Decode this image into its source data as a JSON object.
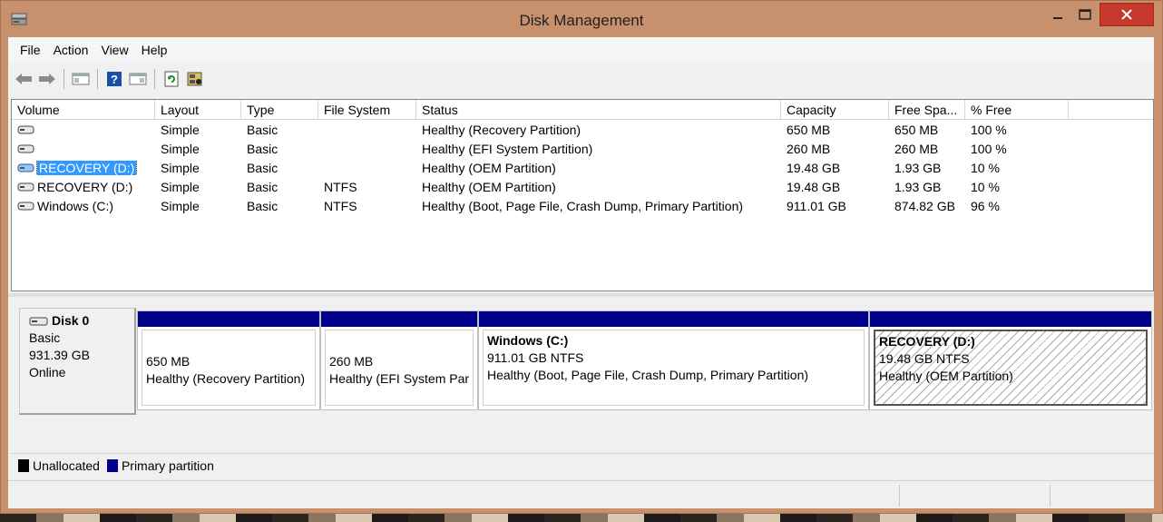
{
  "window": {
    "title": "Disk Management",
    "accent_color": "#c7916d",
    "close_color": "#c7372c"
  },
  "menu": [
    "File",
    "Action",
    "View",
    "Help"
  ],
  "toolbar_icons": [
    "back-arrow-icon",
    "forward-arrow-icon",
    "console-tree-icon",
    "help-icon",
    "properties-icon",
    "refresh-icon",
    "rescan-disks-icon"
  ],
  "volume_list": {
    "columns": [
      "Volume",
      "Layout",
      "Type",
      "File System",
      "Status",
      "Capacity",
      "Free Spa...",
      "% Free"
    ],
    "rows": [
      {
        "volume": "",
        "layout": "Simple",
        "type": "Basic",
        "fs": "",
        "status": "Healthy (Recovery Partition)",
        "capacity": "650 MB",
        "free": "650 MB",
        "pct": "100 %"
      },
      {
        "volume": "",
        "layout": "Simple",
        "type": "Basic",
        "fs": "",
        "status": "Healthy (EFI System Partition)",
        "capacity": "260 MB",
        "free": "260 MB",
        "pct": "100 %"
      },
      {
        "volume": "RECOVERY (D:)",
        "layout": "Simple",
        "type": "Basic",
        "fs": "",
        "status": "Healthy (OEM Partition)",
        "capacity": "19.48 GB",
        "free": "1.93 GB",
        "pct": "10 %",
        "selected": true
      },
      {
        "volume": "RECOVERY (D:)",
        "layout": "Simple",
        "type": "Basic",
        "fs": "NTFS",
        "status": "Healthy (OEM Partition)",
        "capacity": "19.48 GB",
        "free": "1.93 GB",
        "pct": "10 %"
      },
      {
        "volume": "Windows (C:)",
        "layout": "Simple",
        "type": "Basic",
        "fs": "NTFS",
        "status": "Healthy (Boot, Page File, Crash Dump, Primary Partition)",
        "capacity": "911.01 GB",
        "free": "874.82 GB",
        "pct": "96 %"
      }
    ]
  },
  "disk": {
    "name": "Disk 0",
    "type": "Basic",
    "size": "931.39 GB",
    "state": "Online",
    "partitions": [
      {
        "title": "",
        "size": "650 MB",
        "status": "Healthy (Recovery Partition)"
      },
      {
        "title": "",
        "size": "260 MB",
        "status": "Healthy (EFI System Par"
      },
      {
        "title": "Windows  (C:)",
        "size": "911.01 GB NTFS",
        "status": "Healthy (Boot, Page File, Crash Dump, Primary Partition)"
      },
      {
        "title": "RECOVERY  (D:)",
        "size": "19.48 GB NTFS",
        "status": "Healthy (OEM Partition)"
      }
    ]
  },
  "legend": [
    {
      "label": "Unallocated",
      "color": "#000000"
    },
    {
      "label": "Primary partition",
      "color": "#00008b"
    }
  ]
}
